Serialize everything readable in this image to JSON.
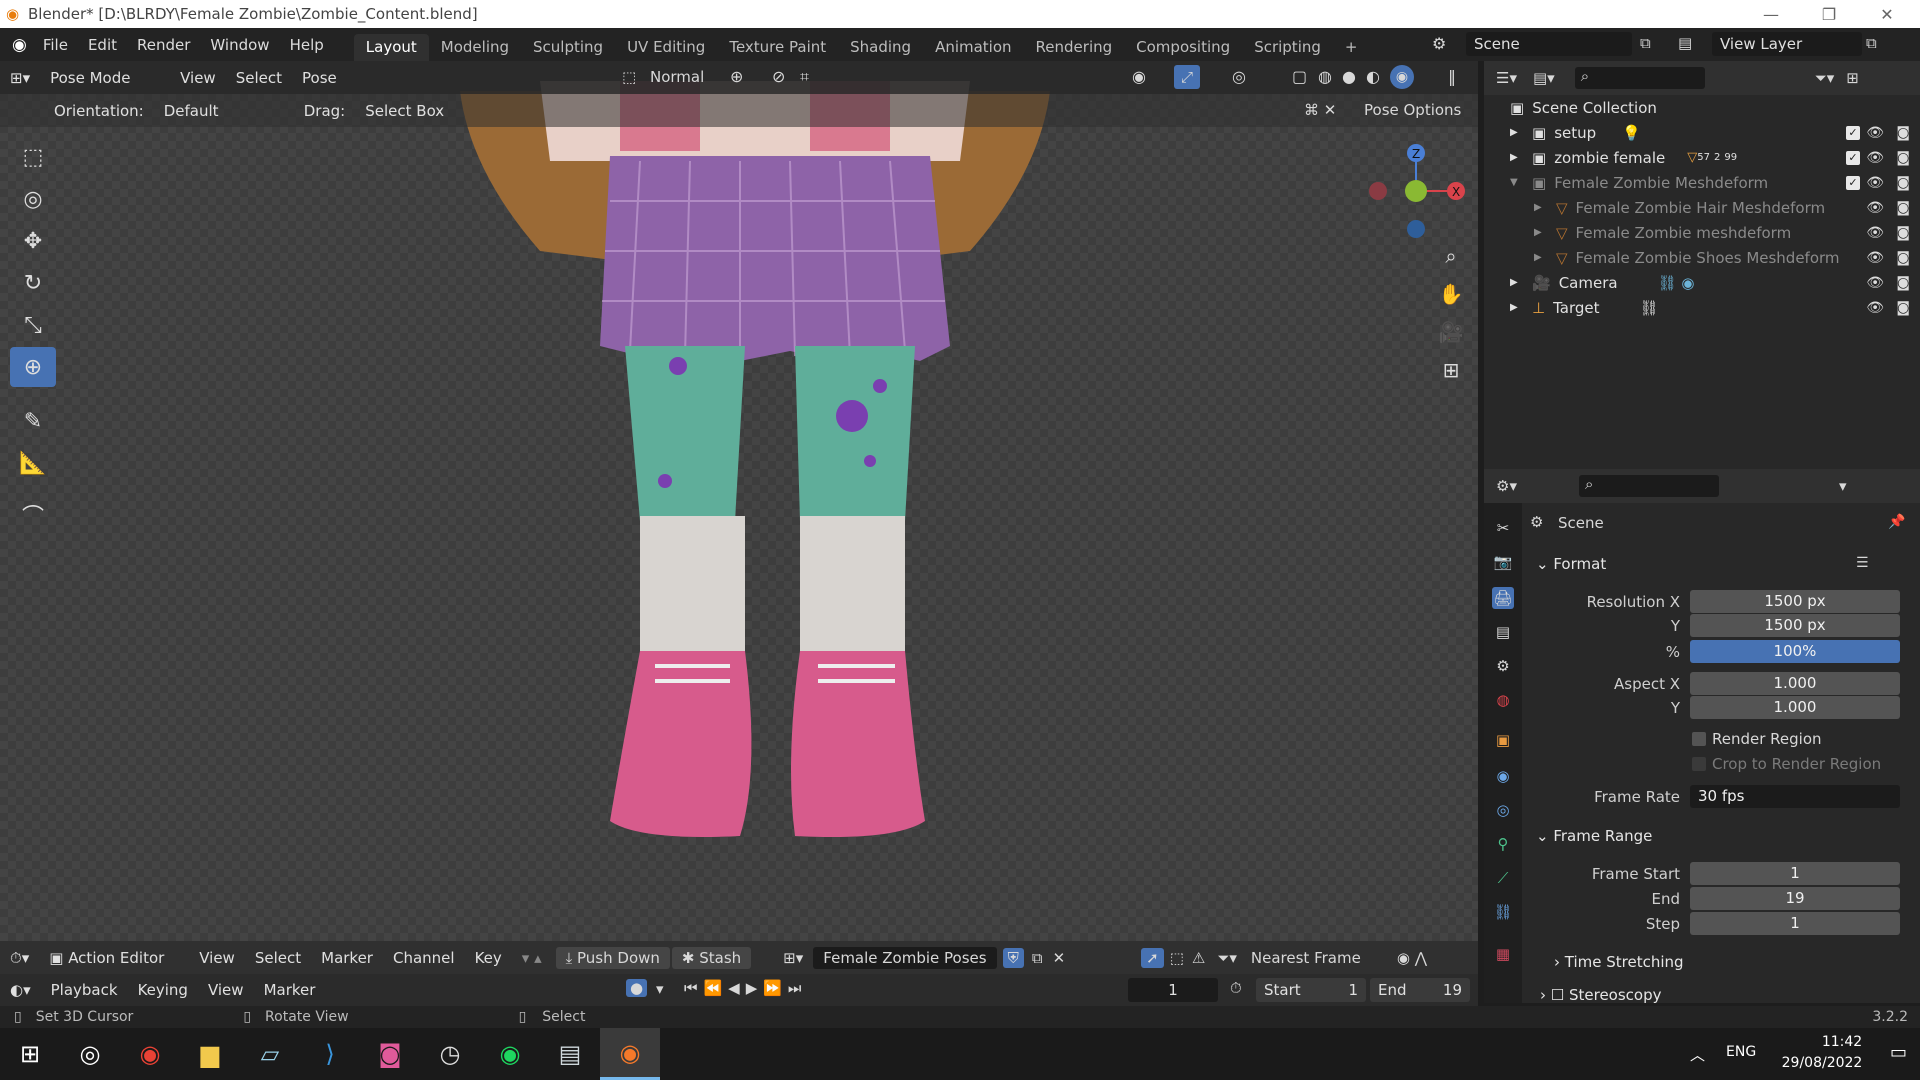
{
  "window": {
    "title": "Blender* [D:\\BLRDY\\Female Zombie\\Zombie_Content.blend]"
  },
  "menu": [
    "File",
    "Edit",
    "Render",
    "Window",
    "Help"
  ],
  "workspaces": [
    "Layout",
    "Modeling",
    "Sculpting",
    "UV Editing",
    "Texture Paint",
    "Shading",
    "Animation",
    "Rendering",
    "Compositing",
    "Scripting"
  ],
  "active_workspace": "Layout",
  "scene_name": "Scene",
  "view_layer": "View Layer",
  "viewport_header": {
    "mode": "Pose Mode",
    "menus": [
      "View",
      "Select",
      "Pose"
    ],
    "transform_orientation": "Normal",
    "orientation_label": "Orientation:",
    "orientation_value": "Default",
    "drag_label": "Drag:",
    "drag_value": "Select Box",
    "pose_options": "Pose Options"
  },
  "outliner": {
    "root": "Scene Collection",
    "items": [
      {
        "label": "setup",
        "indent": 1,
        "checked": true,
        "dim": false
      },
      {
        "label": "zombie female",
        "indent": 1,
        "checked": true,
        "dim": false,
        "badge1": "57",
        "badge2": "2",
        "badge3": "99"
      },
      {
        "label": "Female Zombie Meshdeform",
        "indent": 1,
        "checked": true,
        "dim": true
      },
      {
        "label": "Female Zombie Hair Meshdeform",
        "indent": 2,
        "checked": false,
        "dim": true
      },
      {
        "label": "Female Zombie meshdeform",
        "indent": 2,
        "checked": false,
        "dim": true
      },
      {
        "label": "Female Zombie Shoes Meshdeform",
        "indent": 2,
        "checked": false,
        "dim": true
      },
      {
        "label": "Camera",
        "indent": 1,
        "checked": false,
        "dim": false
      },
      {
        "label": "Target",
        "indent": 1,
        "checked": false,
        "dim": false
      }
    ]
  },
  "properties": {
    "context": "Scene",
    "format_panel": "Format",
    "resolution_x_label": "Resolution X",
    "resolution_x": "1500 px",
    "resolution_y_label": "Y",
    "resolution_y": "1500 px",
    "percent_label": "%",
    "percent": "100%",
    "aspect_x_label": "Aspect X",
    "aspect_x": "1.000",
    "aspect_y_label": "Y",
    "aspect_y": "1.000",
    "render_region": "Render Region",
    "crop_region": "Crop to Render Region",
    "frame_rate_label": "Frame Rate",
    "frame_rate": "30 fps",
    "frame_range_panel": "Frame Range",
    "frame_start_label": "Frame Start",
    "frame_start": "1",
    "end_label": "End",
    "end": "19",
    "step_label": "Step",
    "step": "1",
    "time_stretching": "Time Stretching",
    "stereoscopy": "Stereoscopy"
  },
  "action_editor": {
    "mode": "Action Editor",
    "menus": [
      "View",
      "Select",
      "Marker",
      "Channel",
      "Key"
    ],
    "push_down": "Push Down",
    "stash": "Stash",
    "action_name": "Female Zombie Poses",
    "snap": "Nearest Frame"
  },
  "timeline": {
    "menus": [
      "Playback",
      "Keying",
      "View",
      "Marker"
    ],
    "current_frame": "1",
    "start_label": "Start",
    "start": "1",
    "end_label": "End",
    "end": "19"
  },
  "statusbar": {
    "left": "Set 3D Cursor",
    "middle": "Rotate View",
    "right": "Select",
    "version": "3.2.2"
  },
  "taskbar": {
    "lang": "ENG",
    "time": "11:42",
    "date": "29/08/2022"
  },
  "colors": {
    "accent": "#4772b3",
    "skirt": "#8e63a8",
    "legs": "#5fae9a",
    "socks": "#d8d4d0",
    "shoes": "#d75b8c",
    "coat": "#9b6a36"
  }
}
